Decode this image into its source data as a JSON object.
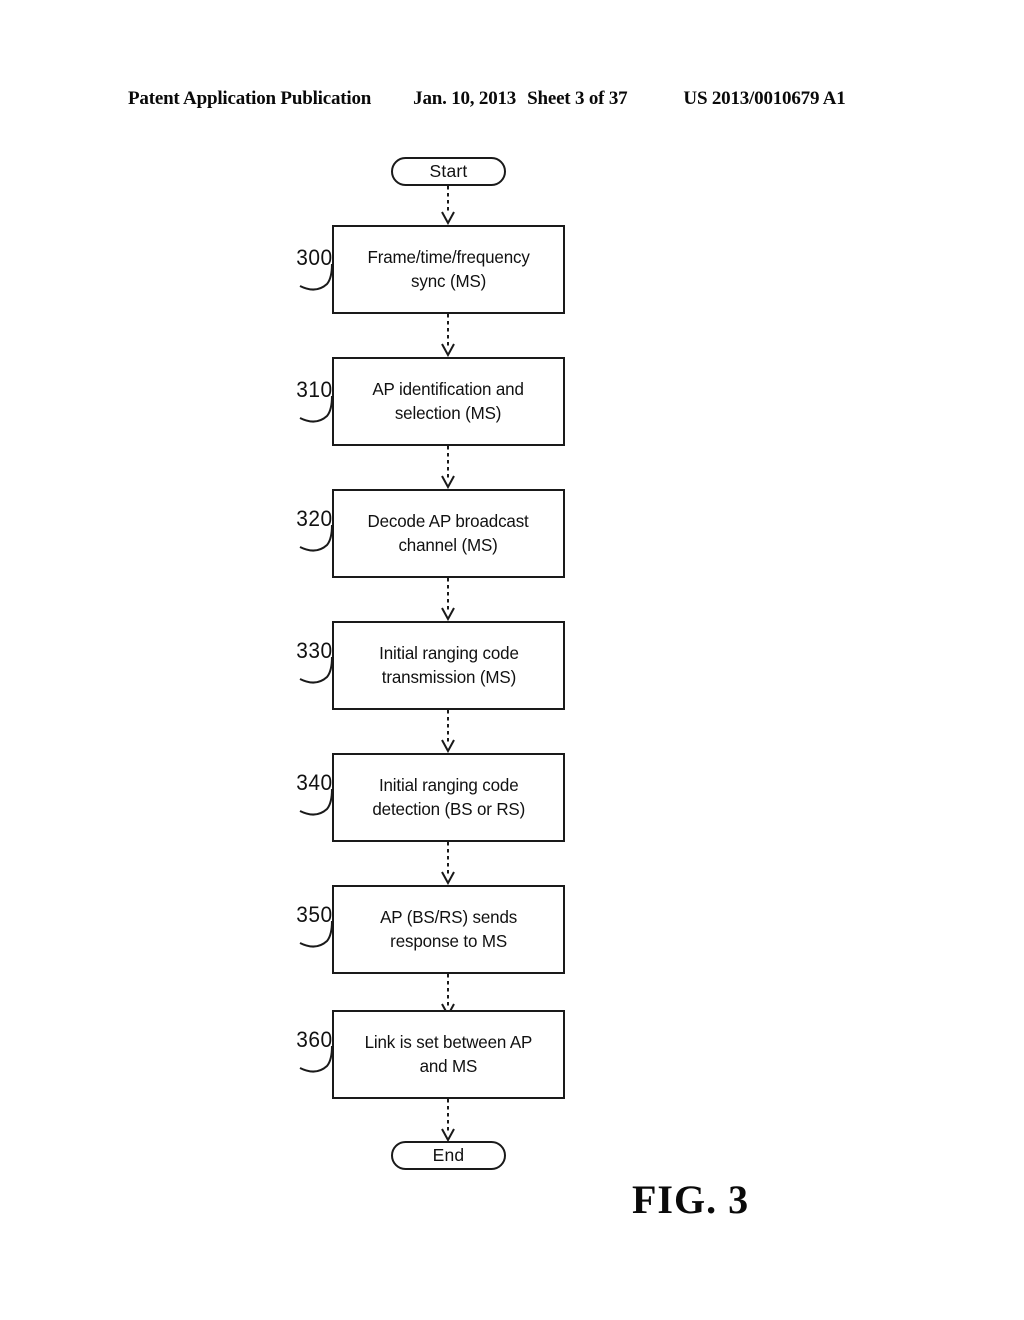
{
  "header": {
    "publication": "Patent Application Publication",
    "date": "Jan. 10, 2013",
    "sheet": "Sheet 3 of 37",
    "patent_number": "US 2013/0010679 A1"
  },
  "figure": {
    "caption": "FIG. 3",
    "type": "flowchart",
    "line_color": "#1a1a1a",
    "background": "#ffffff",
    "connector_style": "dashed-with-open-arrowhead"
  },
  "flowchart": {
    "start_terminator": {
      "label": "Start"
    },
    "end_terminator": {
      "label": "End"
    },
    "steps": [
      {
        "ref": "300",
        "label": "Frame/time/frequency sync (MS)",
        "line1": "Frame/time/frequency",
        "line2": "sync (MS)"
      },
      {
        "ref": "310",
        "label": "AP identification and selection (MS)",
        "line1": "AP identification and",
        "line2": "selection (MS)"
      },
      {
        "ref": "320",
        "label": "Decode AP broadcast channel (MS)",
        "line1": "Decode AP broadcast",
        "line2": "channel (MS)"
      },
      {
        "ref": "330",
        "label": "Initial ranging code transmission (MS)",
        "line1": "Initial ranging code",
        "line2": "transmission (MS)"
      },
      {
        "ref": "340",
        "label": "Initial ranging code detection (BS or RS)",
        "line1": "Initial ranging code",
        "line2": "detection (BS or RS)"
      },
      {
        "ref": "350",
        "label": "AP (BS/RS) sends response to MS",
        "line1": "AP (BS/RS) sends",
        "line2": "response to MS"
      },
      {
        "ref": "360",
        "label": "Link is set between AP and MS",
        "line1": "Link is set between AP",
        "line2": "and MS"
      }
    ]
  }
}
